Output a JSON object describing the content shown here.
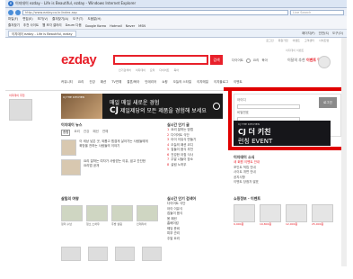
{
  "window": {
    "title": "이지데이 ezday - Life is Beautiful, ezday - Windows Internet Explorer",
    "address": "http://www.ezday.co.kr/index.asp",
    "search_placeholder": "Live Search"
  },
  "menubar": {
    "items": [
      "파일(F)",
      "편집(E)",
      "보기(V)",
      "즐겨찾기(A)",
      "도구(T)",
      "도움말(H)"
    ]
  },
  "favorites": {
    "items": [
      "즐겨찾기",
      "추천 사이트",
      "웹 조각 갤러리",
      "Daum 다음",
      "Google Korea",
      "Hotmail",
      "Naver",
      "MSN"
    ]
  },
  "tab": {
    "label": "이지데이 ezday - Life is Beautiful, ezday"
  },
  "toolbar": {
    "items": [
      "페이지(P)",
      "안전(S)",
      "도구(O)"
    ]
  },
  "site": {
    "top_links": [
      "로그인",
      "회원가입",
      "이벤트",
      "고객센터",
      "사이트맵"
    ],
    "logo": "ezday",
    "search_button": "검색",
    "sub_search": [
      "인기검색어",
      "이지데이",
      "요리",
      "다이어트",
      "육아"
    ],
    "right_links": [
      "다이어트",
      "요리",
      "육아"
    ],
    "promo_title": "이지데이 이벤트",
    "promo_text": "이달의 추천",
    "promo_highlight": "이벤트 당첨",
    "gnb": [
      "커뮤니티",
      "요리",
      "건강",
      "패션",
      "TV연예",
      "결혼/육아",
      "인테리어",
      "쇼핑",
      "오늘의 스타일",
      "이지메일",
      "이지블로그",
      "이벤트"
    ],
    "left_title": "이지데이 추천",
    "banner": {
      "thumb_label": "CJ THE KITCHEN",
      "line1": "매일 매일 새로운 경험",
      "line2_brand": "CJ",
      "line2_text": "제일제당의 모든 제품을 경험해 보세요"
    },
    "login": {
      "label_id": "아이디",
      "label_pw": "비밀번호",
      "button": "로그인",
      "links": "회원가입 | 아이디/비밀번호 찾기"
    },
    "cj_ad": {
      "top": "CJ THE KITCHEN",
      "line1": "CJ 더 키친",
      "line2": "런칭 EVENT"
    },
    "news": {
      "title": "이지데이 뉴스",
      "tabs": [
        "종합",
        "요리",
        "건강",
        "패션",
        "연예"
      ],
      "article": "이 세상 낮은 곳, 외롭고 힘겹게 살아가는 사람들에게 희망을 전하는 사람들의 이야기",
      "article2": "요리 잘하는 여자가 사랑받는 이유, 쉽고 간단한 요리법 공개"
    },
    "popular": {
      "title": "실시간 인기 글",
      "items": [
        "요리 잘하는 방법",
        "다이어트 식단",
        "아이 이유식 만들기",
        "오늘의 패션 코디",
        "집들이 음식 추천",
        "건강한 아침 식사",
        "주말 나들이 장소",
        "살림 노하우"
      ]
    },
    "side_mid": {
      "title": "이지데이 소식",
      "items": [
        "새 회원 이벤트 안내",
        "포인트 적립 안내",
        "사이트 개편 안내",
        "공지사항",
        "이벤트 당첨자 발표"
      ]
    },
    "lower1": {
      "title": "살림의 여왕",
      "cards": [
        "정리 수납",
        "청소 노하우",
        "주방 살림",
        "인테리어"
      ]
    },
    "lower2": {
      "title": "실시간 인기 검색어",
      "items": [
        "다이어트 식단",
        "아이 이유식",
        "집들이 음식",
        "봄 패션",
        "홈베이킹",
        "웨딩 준비",
        "피부 관리",
        "주말 요리"
      ]
    },
    "lower3": {
      "title": "쇼핑정보",
      "title2": "이벤트",
      "prices": [
        "9,900원",
        "19,800원",
        "12,000원",
        "25,000원"
      ]
    }
  },
  "colors": {
    "brand": "#e8202a",
    "highlight": "#e00000"
  }
}
